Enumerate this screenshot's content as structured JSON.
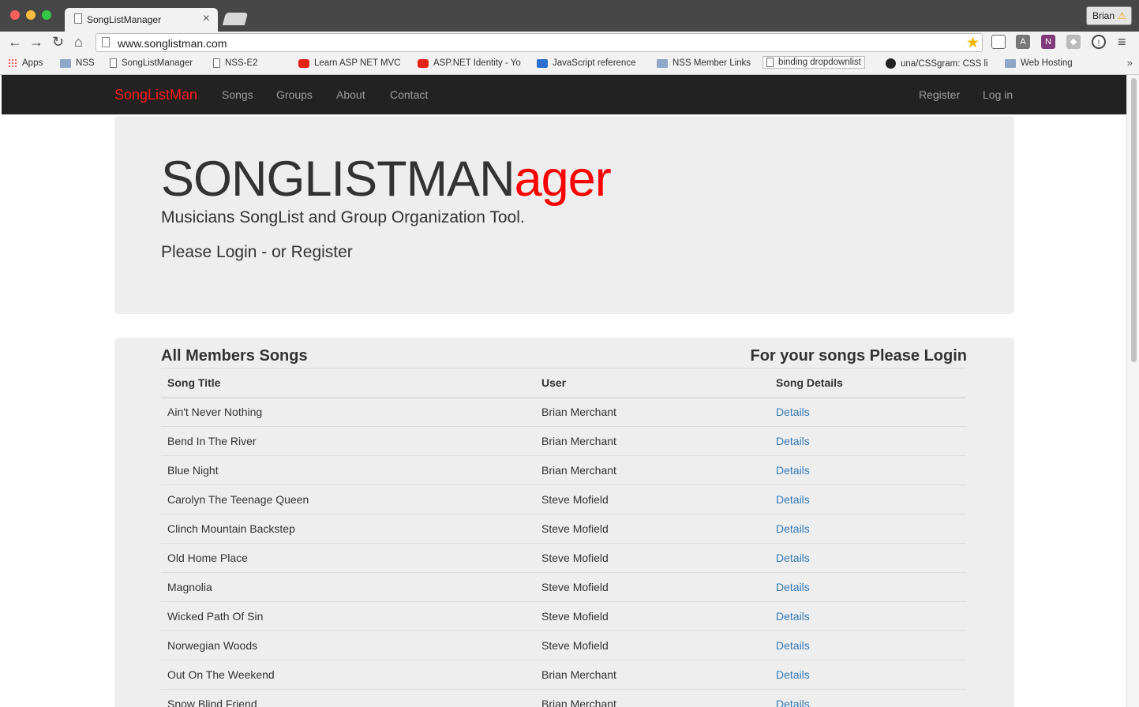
{
  "browser": {
    "tab_title": "SongListManager",
    "tab_close": "×",
    "url": "www.songlistman.com",
    "profile_name": "Brian",
    "bookmarks": [
      {
        "label": "Apps",
        "icon": "apps-grid-icon"
      },
      {
        "label": "NSS",
        "icon": "folder-icon"
      },
      {
        "label": "SongListManager",
        "icon": "page-icon"
      },
      {
        "label": "NSS-E2",
        "icon": "page-icon"
      },
      {
        "label": "Learn ASP NET MVC",
        "icon": "youtube-icon"
      },
      {
        "label": "ASP.NET Identity - Yo",
        "icon": "youtube-icon"
      },
      {
        "label": "JavaScript reference",
        "icon": "mdn-icon"
      },
      {
        "label": "NSS Member Links",
        "icon": "folder-icon"
      },
      {
        "label": "binding dropdownlist",
        "icon": "page-icon"
      },
      {
        "label": "una/CSSgram: CSS li",
        "icon": "github-icon"
      },
      {
        "label": "Web Hosting",
        "icon": "folder-icon"
      }
    ],
    "bookmarks_more": "»"
  },
  "navbar": {
    "brand": "SongListMan",
    "links": [
      "Songs",
      "Groups",
      "About",
      "Contact"
    ],
    "register": "Register",
    "login": "Log in"
  },
  "hero": {
    "title_main": "SONGLISTMAN",
    "title_accent": "ager",
    "subtitle": "Musicians SongList and Group Organization Tool.",
    "login_prompt": "Please Login - or Register"
  },
  "songs": {
    "heading": "All Members Songs",
    "login_note": "For your songs Please Login",
    "columns": [
      "Song Title",
      "User",
      "Song Details"
    ],
    "rows": [
      {
        "title": "Ain't Never Nothing",
        "user": "Brian Merchant",
        "details": "Details"
      },
      {
        "title": "Bend In The River",
        "user": "Brian Merchant",
        "details": "Details"
      },
      {
        "title": "Blue Night",
        "user": "Brian Merchant",
        "details": "Details"
      },
      {
        "title": "Carolyn The Teenage Queen",
        "user": "Steve Mofield",
        "details": "Details"
      },
      {
        "title": "Clinch Mountain Backstep",
        "user": "Steve Mofield",
        "details": "Details"
      },
      {
        "title": "Old Home Place",
        "user": "Steve Mofield",
        "details": "Details"
      },
      {
        "title": "Magnolia",
        "user": "Steve Mofield",
        "details": "Details"
      },
      {
        "title": "Wicked Path Of Sin",
        "user": "Steve Mofield",
        "details": "Details"
      },
      {
        "title": "Norwegian Woods",
        "user": "Steve Mofield",
        "details": "Details"
      },
      {
        "title": "Out On The Weekend",
        "user": "Brian Merchant",
        "details": "Details"
      },
      {
        "title": "Snow Blind Friend",
        "user": "Brian Merchant",
        "details": "Details"
      }
    ]
  },
  "colors": {
    "brand_red": "#ff1a1a",
    "navbar_bg": "#222222",
    "link_blue": "#337ab7",
    "panel_bg": "#eeeeee"
  }
}
